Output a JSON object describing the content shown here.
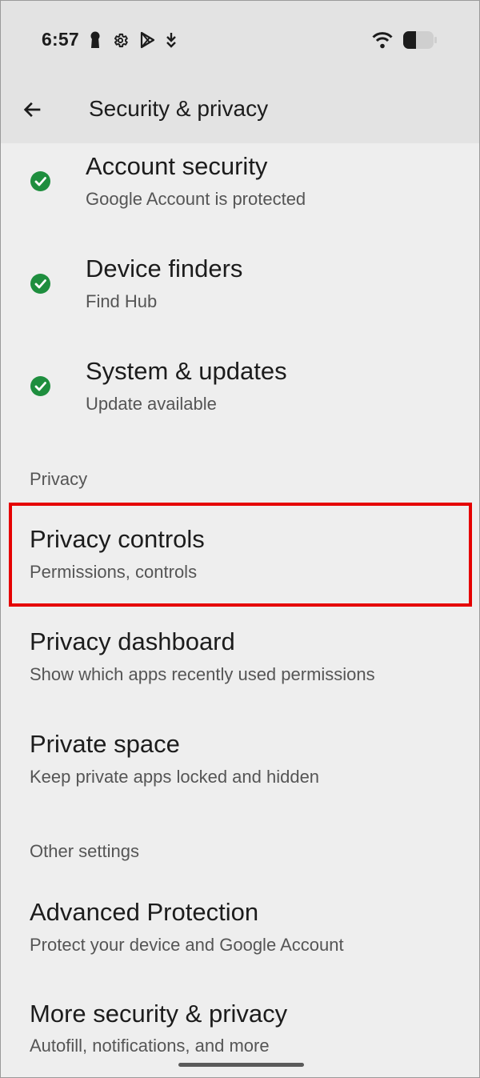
{
  "status_bar": {
    "time": "6:57",
    "left_icons": [
      "keyhole-icon",
      "settings-gear-icon",
      "play-store-icon",
      "download-arrow-icon"
    ],
    "right_icons": [
      "wifi-icon",
      "battery-icon"
    ]
  },
  "app_bar": {
    "back_icon": "arrow-left-icon",
    "title": "Security & privacy"
  },
  "security_items": [
    {
      "title": "Account security",
      "subtitle": "Google Account is protected",
      "status_icon": "check-circle-icon",
      "status_color": "#1e8e3e"
    },
    {
      "title": "Device finders",
      "subtitle": "Find Hub",
      "status_icon": "check-circle-icon",
      "status_color": "#1e8e3e"
    },
    {
      "title": "System & updates",
      "subtitle": "Update available",
      "status_icon": "check-circle-icon",
      "status_color": "#1e8e3e"
    }
  ],
  "privacy_section": {
    "header": "Privacy",
    "items": [
      {
        "title": "Privacy controls",
        "subtitle": "Permissions, controls",
        "highlighted": true
      },
      {
        "title": "Privacy dashboard",
        "subtitle": "Show which apps recently used permissions"
      },
      {
        "title": "Private space",
        "subtitle": "Keep private apps locked and hidden"
      }
    ]
  },
  "other_section": {
    "header": "Other settings",
    "items": [
      {
        "title": "Advanced Protection",
        "subtitle": "Protect your device and Google Account"
      },
      {
        "title": "More security & privacy",
        "subtitle": "Autofill, notifications, and more"
      }
    ]
  },
  "colors": {
    "background": "#eeeeee",
    "app_bar": "#e3e3e3",
    "highlight": "#e50000",
    "check_green": "#1e8e3e"
  }
}
